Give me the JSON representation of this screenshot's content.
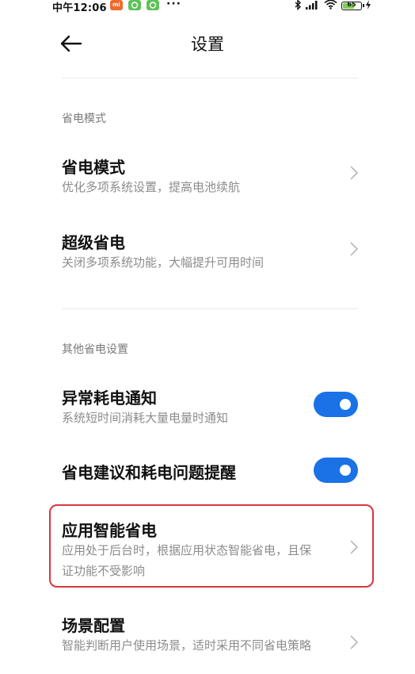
{
  "status_bar": {
    "time": "中午12:06",
    "apps": [
      {
        "name": "mi-app-icon",
        "label": "mi",
        "color": "#f06a2e"
      },
      {
        "name": "chat-app-icon",
        "label": "",
        "color": "#5fc15a"
      },
      {
        "name": "chat-app-icon-2",
        "label": "",
        "color": "#5fc15a"
      }
    ],
    "more_dots": "···",
    "battery_level": "65",
    "battery_percent": 0.65,
    "icons": [
      "bluetooth-icon",
      "signal-icon",
      "wifi-icon",
      "battery-icon",
      "charging-icon"
    ]
  },
  "header": {
    "title": "设置",
    "back_icon": "back-arrow-icon"
  },
  "sections": [
    {
      "label": "省电模式",
      "items": [
        {
          "title": "省电模式",
          "subtitle": "优化多项系统设置，提高电池续航",
          "control": "chevron"
        },
        {
          "title": "超级省电",
          "subtitle": "关闭多项系统功能，大幅提升可用时间",
          "control": "chevron"
        }
      ]
    },
    {
      "label": "其他省电设置",
      "items": [
        {
          "title": "异常耗电通知",
          "subtitle": "系统短时间消耗大量电量时通知",
          "control": "toggle",
          "on": true
        },
        {
          "title": "省电建议和耗电问题提醒",
          "subtitle": "",
          "control": "toggle",
          "on": true
        },
        {
          "title": "应用智能省电",
          "subtitle": "应用处于后台时，根据应用状态智能省电，且保证功能不受影响",
          "control": "chevron",
          "highlighted": true
        },
        {
          "title": "场景配置",
          "subtitle": "智能判断用户使用场景，适时采用不同省电策略",
          "control": "chevron"
        }
      ]
    }
  ],
  "colors": {
    "toggle_on": "#1a72e6",
    "highlight": "#d9363e",
    "subtitle": "#8c8c8c",
    "section_label": "#7a7a7a"
  }
}
